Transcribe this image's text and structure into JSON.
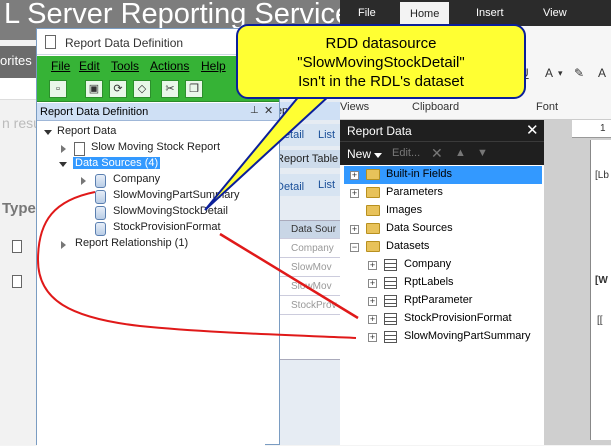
{
  "ssrs_background": {
    "title": "L Server Reporting Services",
    "favorites_label": "orites",
    "search_results_label": "n resu",
    "type_header": "Type"
  },
  "rdd_window": {
    "title": "Report Data Definition",
    "menu": [
      {
        "label": "File",
        "key": "F"
      },
      {
        "label": "Edit",
        "key": "E"
      },
      {
        "label": "Tools",
        "key": "T"
      },
      {
        "label": "Actions",
        "key": "A"
      },
      {
        "label": "Help",
        "key": "H"
      }
    ],
    "pane_title": "Report Data Definition",
    "tree": {
      "root": "Report Data",
      "report": "Slow Moving Stock Report",
      "data_sources_label": "Data Sources (4)",
      "data_sources": [
        "Company",
        "SlowMovingPartSummary",
        "SlowMovingStockDetail",
        "StockProvisionFormat"
      ],
      "relationship": "Report Relationship (1)"
    }
  },
  "mid_window": {
    "header": "Report D",
    "tabs_top": [
      "Detail",
      "List"
    ],
    "subbar": "Report Table",
    "tabs_bottom": [
      "Detail",
      "List"
    ],
    "grid_header": "Data Sour",
    "grid_rows": [
      "Company",
      "SlowMov",
      "SlowMov",
      "StockProv"
    ]
  },
  "ribbon": {
    "tabs": [
      "File",
      "Home",
      "Insert",
      "View"
    ],
    "active_tab": "Home",
    "groups": [
      "Views",
      "Clipboard",
      "Font"
    ]
  },
  "report_data_panel": {
    "title": "Report Data",
    "new_label": "New",
    "edit_label": "Edit...",
    "items": [
      {
        "label": "Built-in Fields",
        "type": "folder",
        "selected": true
      },
      {
        "label": "Parameters",
        "type": "folder"
      },
      {
        "label": "Images",
        "type": "folder"
      },
      {
        "label": "Data Sources",
        "type": "folder"
      },
      {
        "label": "Datasets",
        "type": "folder",
        "expanded": true
      }
    ],
    "datasets": [
      "Company",
      "RptLabels",
      "RptParameter",
      "StockProvisionFormat",
      "SlowMovingPartSummary"
    ]
  },
  "design_area": {
    "ruler_mark": "1",
    "cells": [
      "[Lb",
      "[W",
      "[["
    ]
  },
  "callout": {
    "lines": [
      "RDD datasource",
      "\"SlowMovingStockDetail\"",
      "Isn't in the RDL's dataset"
    ],
    "fill_color": "#ffff33",
    "border_color": "#0b1f9a"
  },
  "annotation_color": "#e01919"
}
